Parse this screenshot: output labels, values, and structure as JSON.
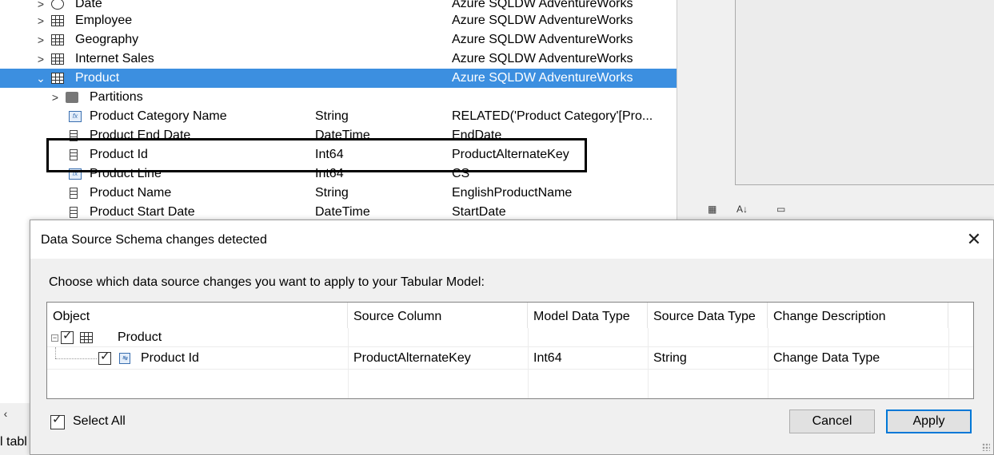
{
  "tree": {
    "rows": [
      {
        "label": "Date",
        "type": "",
        "value": "Azure SQLDW AdventureWorks",
        "expander": ">",
        "icon": "clock-icon"
      },
      {
        "label": "Employee",
        "type": "",
        "value": "Azure SQLDW AdventureWorks",
        "expander": ">",
        "icon": "table-icon"
      },
      {
        "label": "Geography",
        "type": "",
        "value": "Azure SQLDW AdventureWorks",
        "expander": ">",
        "icon": "table-icon"
      },
      {
        "label": "Internet Sales",
        "type": "",
        "value": "Azure SQLDW AdventureWorks",
        "expander": ">",
        "icon": "table-icon"
      },
      {
        "label": "Product",
        "type": "",
        "value": "Azure SQLDW AdventureWorks",
        "expander": "⌄",
        "icon": "table-icon"
      },
      {
        "label": "Partitions",
        "type": "",
        "value": "",
        "expander": ">",
        "icon": "partitions-icon"
      },
      {
        "label": "Product Category Name",
        "type": "String",
        "value": "RELATED('Product Category'[Pro...",
        "expander": "",
        "icon": "calculated-column-icon"
      },
      {
        "label": "Product End Date",
        "type": "DateTime",
        "value": "EndDate",
        "expander": "",
        "icon": "column-icon"
      },
      {
        "label": "Product Id",
        "type": "Int64",
        "value": "ProductAlternateKey",
        "expander": "",
        "icon": "column-icon"
      },
      {
        "label": "Product Line",
        "type": "Int64",
        "value": "CS",
        "expander": "",
        "icon": "calculated-column-icon"
      },
      {
        "label": "Product Name",
        "type": "String",
        "value": "EnglishProductName",
        "expander": "",
        "icon": "column-icon"
      },
      {
        "label": "Product Start Date",
        "type": "DateTime",
        "value": "StartDate",
        "expander": "",
        "icon": "column-icon"
      }
    ]
  },
  "status_fragment": "l tabl",
  "dialog": {
    "title": "Data Source Schema changes detected",
    "close_glyph": "✕",
    "instruction": "Choose which data source changes you want to apply to your Tabular Model:",
    "columns": [
      "Object",
      "Source Column",
      "Model Data Type",
      "Source Data Type",
      "Change Description"
    ],
    "rows": [
      {
        "object": "Product",
        "source_column": "",
        "model_type": "",
        "source_type": "",
        "description": ""
      },
      {
        "object": "Product Id",
        "source_column": "ProductAlternateKey",
        "model_type": "Int64",
        "source_type": "String",
        "description": "Change Data Type"
      }
    ],
    "select_all_label": "Select All",
    "cancel_label": "Cancel",
    "apply_label": "Apply"
  },
  "colors": {
    "selection": "#3c8fe0",
    "accent": "#0078d7"
  }
}
